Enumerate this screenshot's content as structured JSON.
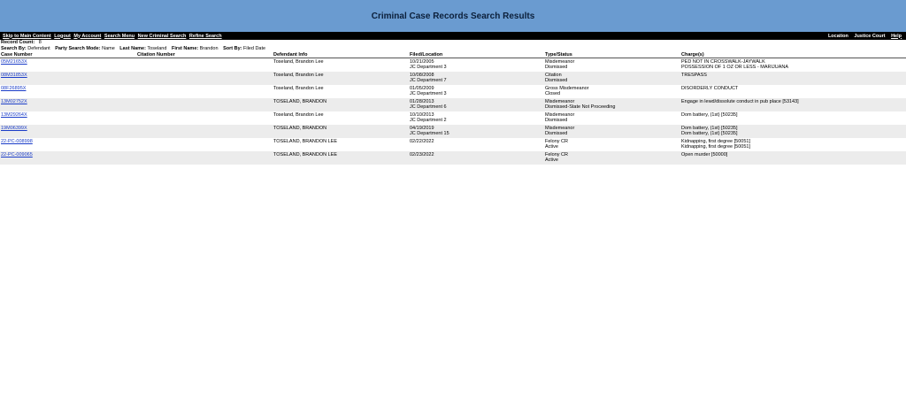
{
  "header": {
    "title": "Criminal Case Records Search Results"
  },
  "nav": {
    "left": [
      "Skip to Main Content",
      "Logout",
      "My Account",
      "Search Menu",
      "New Criminal Search",
      "Refine Search"
    ],
    "location_label": "Location",
    "location_value": "Justice Court",
    "help": "Help"
  },
  "meta": {
    "record_count_label": "Record Count:",
    "record_count": "8",
    "search_by_label": "Search By:",
    "search_by": "Defendant",
    "party_mode_label": "Party Search Mode:",
    "party_mode": "Name",
    "last_name_label": "Last Name:",
    "last_name": "Toseland",
    "first_name_label": "First Name:",
    "first_name": "Brandon",
    "sort_label": "Sort By:",
    "sort": "Filed Date"
  },
  "table": {
    "headers": [
      "Case Number",
      "Citation Number",
      "Defendant Info",
      "Filed/Location",
      "Type/Status",
      "Charge(s)"
    ],
    "rows": [
      {
        "case": "05M21653X",
        "citation": "",
        "defendant": "Toseland, Brandon Lee",
        "filed": [
          "10/21/2005",
          "JC Department 3"
        ],
        "type": [
          "Misdemeanor",
          "Dismissed"
        ],
        "charges": [
          "PED NOT IN CROSSWALK-JAYWALK",
          "POSSESSION OF 1 OZ OR LESS - MARIJUANA"
        ]
      },
      {
        "case": "08M31853X",
        "citation": "",
        "defendant": "Toseland, Brandon Lee",
        "filed": [
          "10/08/2008",
          "JC Department 7"
        ],
        "type": [
          "Citation",
          "Dismissed"
        ],
        "charges": [
          "TRESPASS"
        ]
      },
      {
        "case": "08F26895X",
        "citation": "",
        "defendant": "Toseland, Brandon Lee",
        "filed": [
          "01/05/2009",
          "JC Department 3"
        ],
        "type": [
          "Gross Misdemeanor",
          "Closed"
        ],
        "charges": [
          "DISORDERLY CONDUCT"
        ]
      },
      {
        "case": "13M02752X",
        "citation": "",
        "defendant": "TOSELAND, BRANDON",
        "filed": [
          "01/28/2013",
          "JC Department 6"
        ],
        "type": [
          "Misdemeanor",
          "Dismissed-State Not Proceeding"
        ],
        "charges": [
          "Engage in lewd/dissolute conduct in pub place [53143]"
        ]
      },
      {
        "case": "13M29264X",
        "citation": "",
        "defendant": "Toseland, Brandon Lee",
        "filed": [
          "10/10/2013",
          "JC Department 2"
        ],
        "type": [
          "Misdemeanor",
          "Dismissed"
        ],
        "charges": [
          "Dom battery, (1st) [50235]"
        ]
      },
      {
        "case": "19M06399X",
        "citation": "",
        "defendant": "TOSELAND, BRANDON",
        "filed": [
          "04/19/2019",
          "JC Department 15"
        ],
        "type": [
          "Misdemeanor",
          "Dismissed"
        ],
        "charges": [
          "Dom battery, (1st) [50235]",
          "Dom battery, (1st) [50235]"
        ]
      },
      {
        "case": "22-PC-008998",
        "citation": "",
        "defendant": "TOSELAND, BRANDON LEE",
        "filed": [
          "02/22/2022"
        ],
        "type": [
          "Felony CR",
          "Active"
        ],
        "charges": [
          "Kidnapping, first degree [50051]",
          "Kidnapping, first degree [50051]"
        ]
      },
      {
        "case": "22-PC-009065",
        "citation": "",
        "defendant": "TOSELAND, BRANDON LEE",
        "filed": [
          "02/23/2022"
        ],
        "type": [
          "Felony CR",
          "Active"
        ],
        "charges": [
          "Open murder [50000]"
        ]
      }
    ]
  }
}
